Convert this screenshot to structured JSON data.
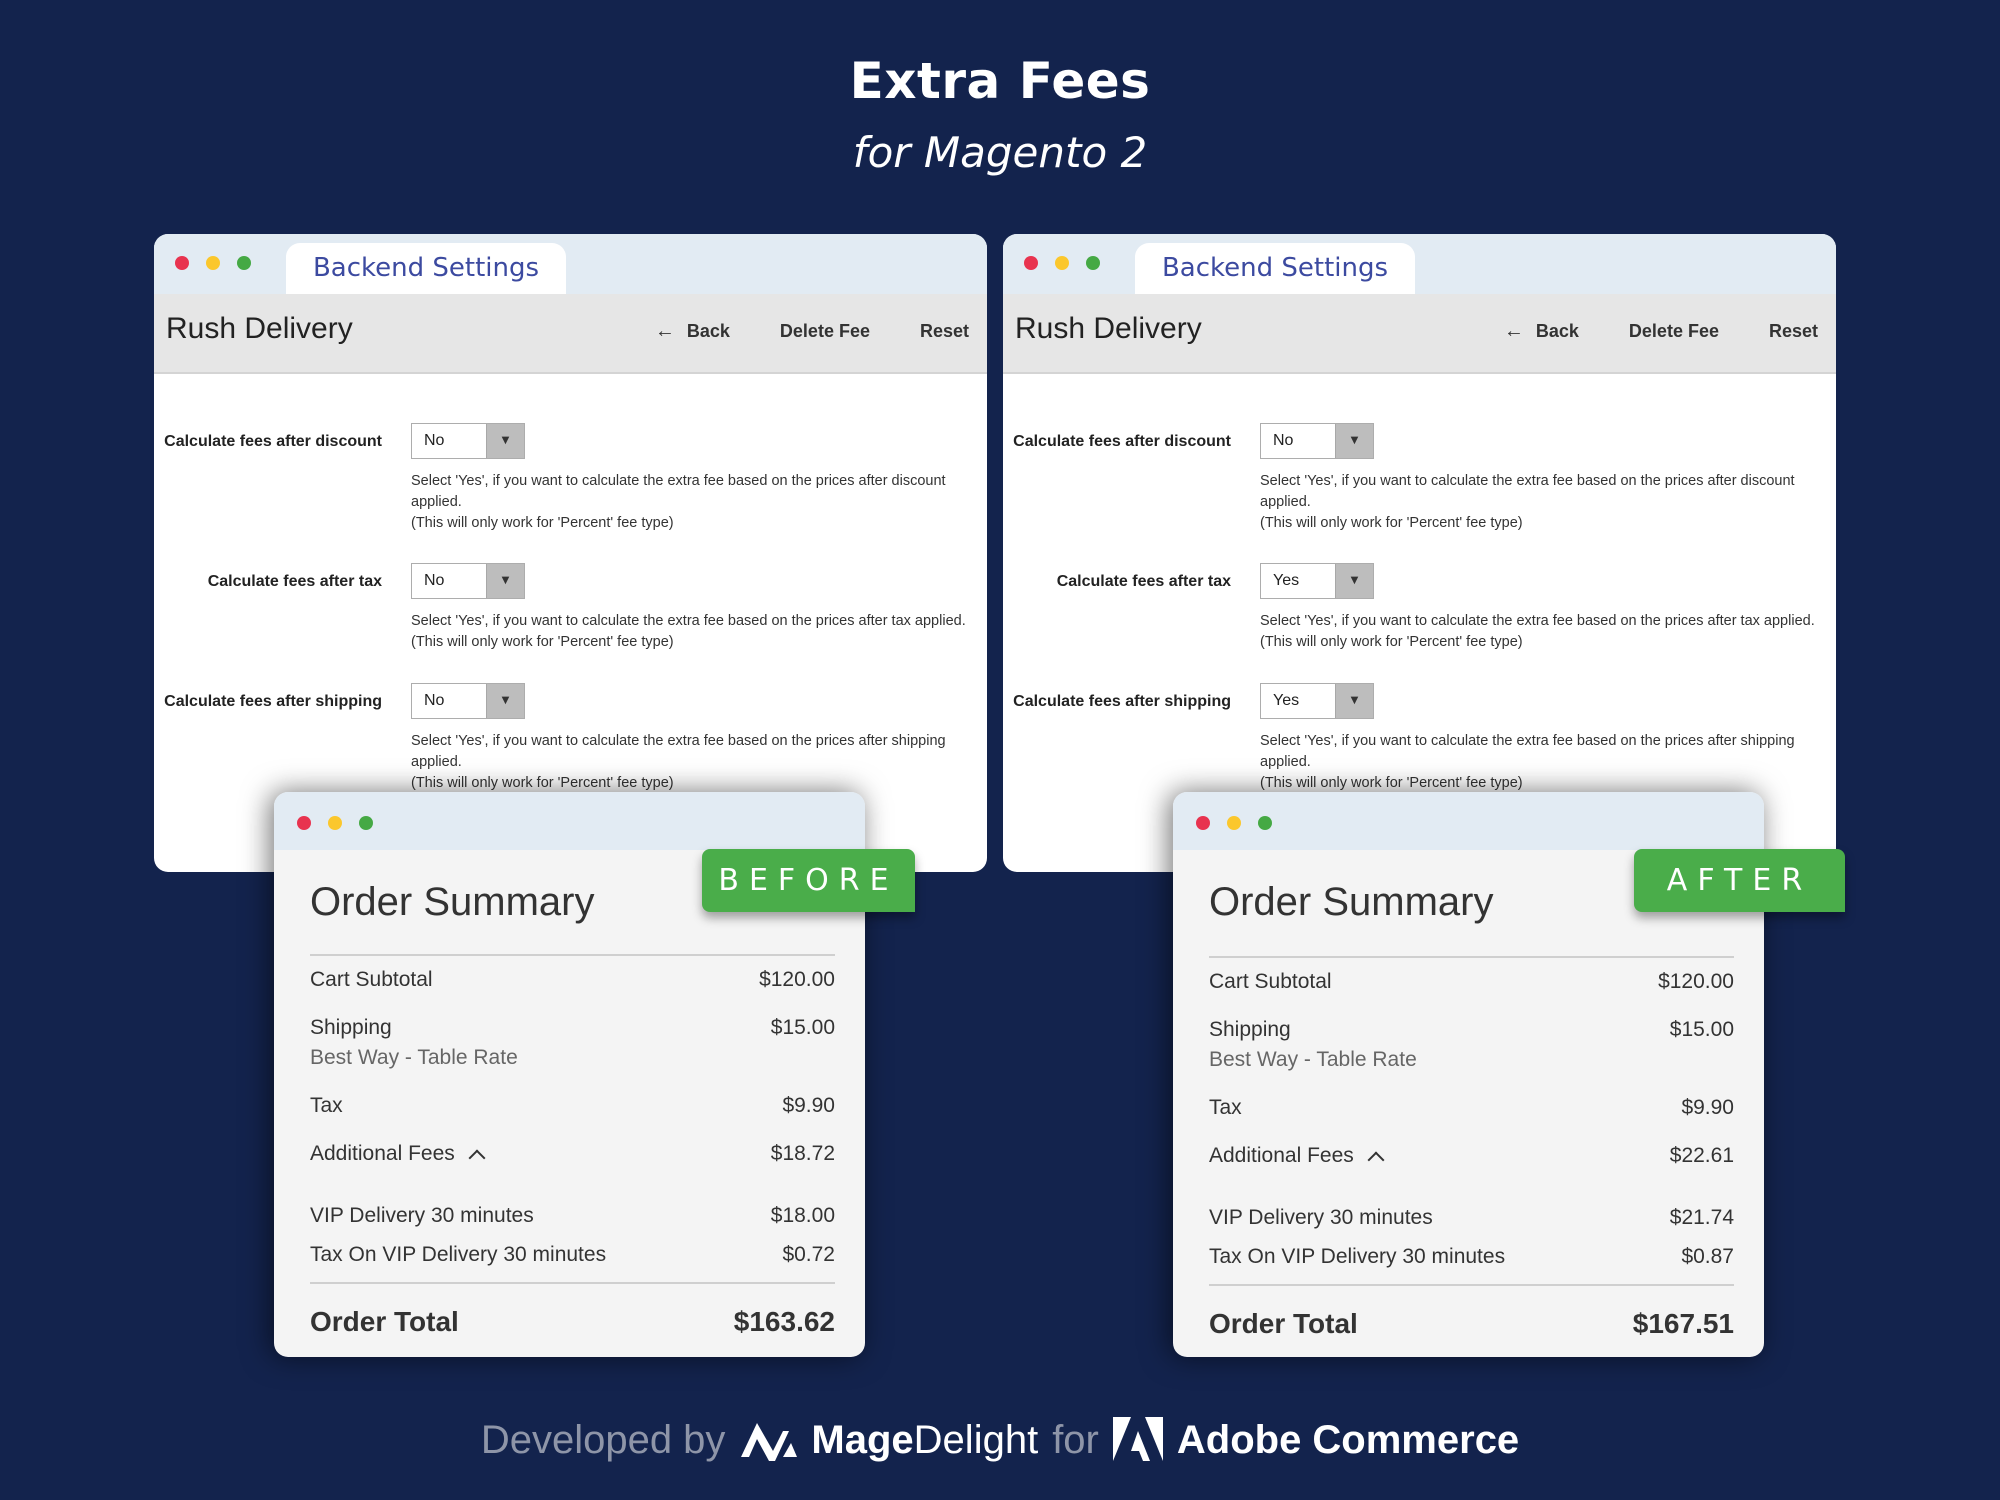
{
  "hero": {
    "title": "Extra Fees",
    "subtitle": "for Magento 2"
  },
  "colors": {
    "background": "#13234d",
    "badge_green": "#4aad4a",
    "tab_text": "#3c4aa0",
    "dot_red": "#e8334f",
    "dot_yellow": "#fbc72c",
    "dot_green": "#45a944"
  },
  "backend_left": {
    "tab_label": "Backend Settings",
    "page_title": "Rush Delivery",
    "actions": {
      "back": "Back",
      "delete": "Delete Fee",
      "reset": "Reset"
    },
    "fields": [
      {
        "label": "Calculate fees after discount",
        "value": "No",
        "help": [
          "Select 'Yes', if you want to calculate the extra fee based on the prices after discount applied.",
          "(This will only work for 'Percent' fee type)"
        ]
      },
      {
        "label": "Calculate fees after tax",
        "value": "No",
        "help": [
          "Select 'Yes', if you want to calculate the extra fee based on the prices after tax applied.",
          "(This will only work for 'Percent' fee type)"
        ]
      },
      {
        "label": "Calculate fees after shipping",
        "value": "No",
        "help": [
          "Select 'Yes', if you want to calculate the extra fee based on the prices after shipping applied.",
          "(This will only work for 'Percent' fee type)"
        ]
      }
    ]
  },
  "backend_right": {
    "tab_label": "Backend Settings",
    "page_title": "Rush Delivery",
    "actions": {
      "back": "Back",
      "delete": "Delete Fee",
      "reset": "Reset"
    },
    "fields": [
      {
        "label": "Calculate fees after discount",
        "value": "No",
        "help": [
          "Select 'Yes', if you want to calculate the extra fee based on the prices after discount applied.",
          "(This will only work for 'Percent' fee type)"
        ]
      },
      {
        "label": "Calculate fees after tax",
        "value": "Yes",
        "help": [
          "Select 'Yes', if you want to calculate the extra fee based on the prices after tax applied.",
          "(This will only work for 'Percent' fee type)"
        ]
      },
      {
        "label": "Calculate fees after shipping",
        "value": "Yes",
        "help": [
          "Select 'Yes', if you want to calculate the extra fee based on the prices after shipping applied.",
          "(This will only work for 'Percent' fee type)"
        ]
      }
    ]
  },
  "summary_before": {
    "badge": "BEFORE",
    "title": "Order Summary",
    "cart_subtotal": {
      "label": "Cart Subtotal",
      "value": "$120.00"
    },
    "shipping": {
      "label": "Shipping",
      "method": "Best Way - Table Rate",
      "value": "$15.00"
    },
    "tax": {
      "label": "Tax",
      "value": "$9.90"
    },
    "additional_fees": {
      "label": "Additional Fees",
      "value": "$18.72"
    },
    "fee_items": [
      {
        "label": "VIP Delivery 30 minutes",
        "value": "$18.00"
      },
      {
        "label": "Tax On VIP Delivery 30 minutes",
        "value": "$0.72"
      }
    ],
    "order_total": {
      "label": "Order Total",
      "value": "$163.62"
    }
  },
  "summary_after": {
    "badge": "AFTER",
    "title": "Order Summary",
    "cart_subtotal": {
      "label": "Cart Subtotal",
      "value": "$120.00"
    },
    "shipping": {
      "label": "Shipping",
      "method": "Best Way - Table Rate",
      "value": "$15.00"
    },
    "tax": {
      "label": "Tax",
      "value": "$9.90"
    },
    "additional_fees": {
      "label": "Additional Fees",
      "value": "$22.61"
    },
    "fee_items": [
      {
        "label": "VIP Delivery 30 minutes",
        "value": "$21.74"
      },
      {
        "label": "Tax On VIP Delivery 30 minutes",
        "value": "$0.87"
      }
    ],
    "order_total": {
      "label": "Order Total",
      "value": "$167.51"
    }
  },
  "footer": {
    "developed_by": "Developed by",
    "brand_bold": "Mage",
    "brand_light": "Delight",
    "for": "for",
    "platform": "Adobe Commerce"
  }
}
